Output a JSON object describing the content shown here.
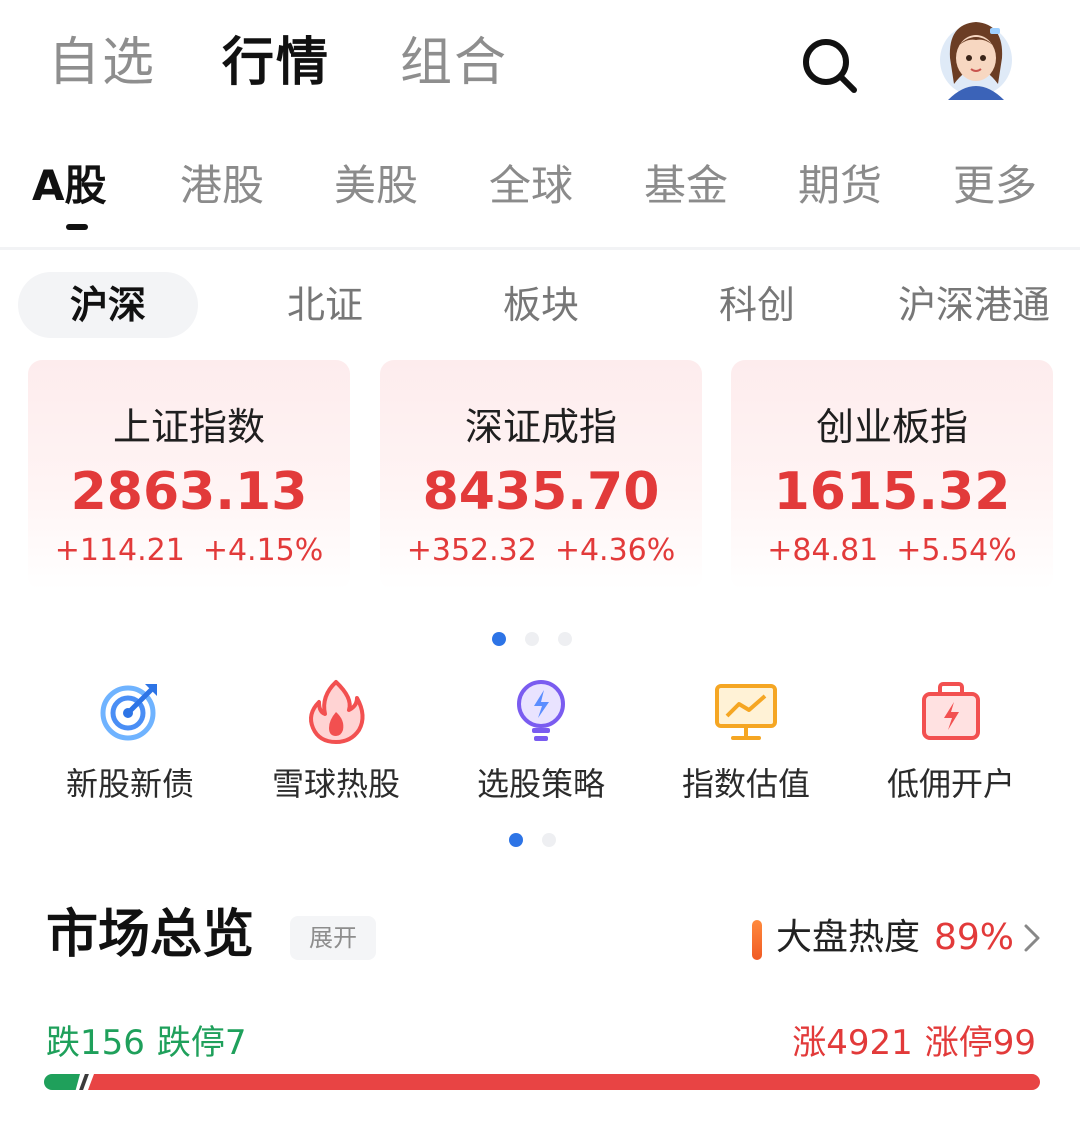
{
  "top_nav": {
    "tabs": [
      {
        "label": "自选",
        "active": false
      },
      {
        "label": "行情",
        "active": true
      },
      {
        "label": "组合",
        "active": false
      }
    ],
    "search_icon": "search-icon",
    "avatar_icon": "avatar"
  },
  "market_tabs": {
    "items": [
      {
        "label": "A股",
        "active": true
      },
      {
        "label": "港股",
        "active": false
      },
      {
        "label": "美股",
        "active": false
      },
      {
        "label": "全球",
        "active": false
      },
      {
        "label": "基金",
        "active": false
      },
      {
        "label": "期货",
        "active": false
      },
      {
        "label": "更多",
        "active": false
      }
    ]
  },
  "sub_tabs": {
    "items": [
      {
        "label": "沪深",
        "active": true
      },
      {
        "label": "北证",
        "active": false
      },
      {
        "label": "板块",
        "active": false
      },
      {
        "label": "科创",
        "active": false
      },
      {
        "label": "沪深港通",
        "active": false
      }
    ]
  },
  "index_cards": [
    {
      "name": "上证指数",
      "value": "2863.13",
      "change": "+114.21",
      "change_pct": "+4.15%"
    },
    {
      "name": "深证成指",
      "value": "8435.70",
      "change": "+352.32",
      "change_pct": "+4.36%"
    },
    {
      "name": "创业板指",
      "value": "1615.32",
      "change": "+84.81",
      "change_pct": "+5.54%"
    }
  ],
  "card_pager": {
    "count": 3,
    "active": 0
  },
  "shortcuts": [
    {
      "label": "新股新债",
      "icon": "target-icon"
    },
    {
      "label": "雪球热股",
      "icon": "flame-icon"
    },
    {
      "label": "选股策略",
      "icon": "bulb-icon"
    },
    {
      "label": "指数估值",
      "icon": "chart-board-icon"
    },
    {
      "label": "低佣开户",
      "icon": "bag-icon"
    }
  ],
  "shortcut_pager": {
    "count": 2,
    "active": 0
  },
  "overview": {
    "title": "市场总览",
    "expand_label": "展开",
    "heat_label": "大盘热度",
    "heat_value": "89%",
    "fall_label": "跌156",
    "limit_down_label": "跌停7",
    "rise_label": "涨4921",
    "limit_up_label": "涨停99",
    "fall_count": 156,
    "rise_count": 4921
  },
  "colors": {
    "rise": "#e23a3a",
    "fall": "#1fa05b",
    "accent": "#2d74e6"
  }
}
